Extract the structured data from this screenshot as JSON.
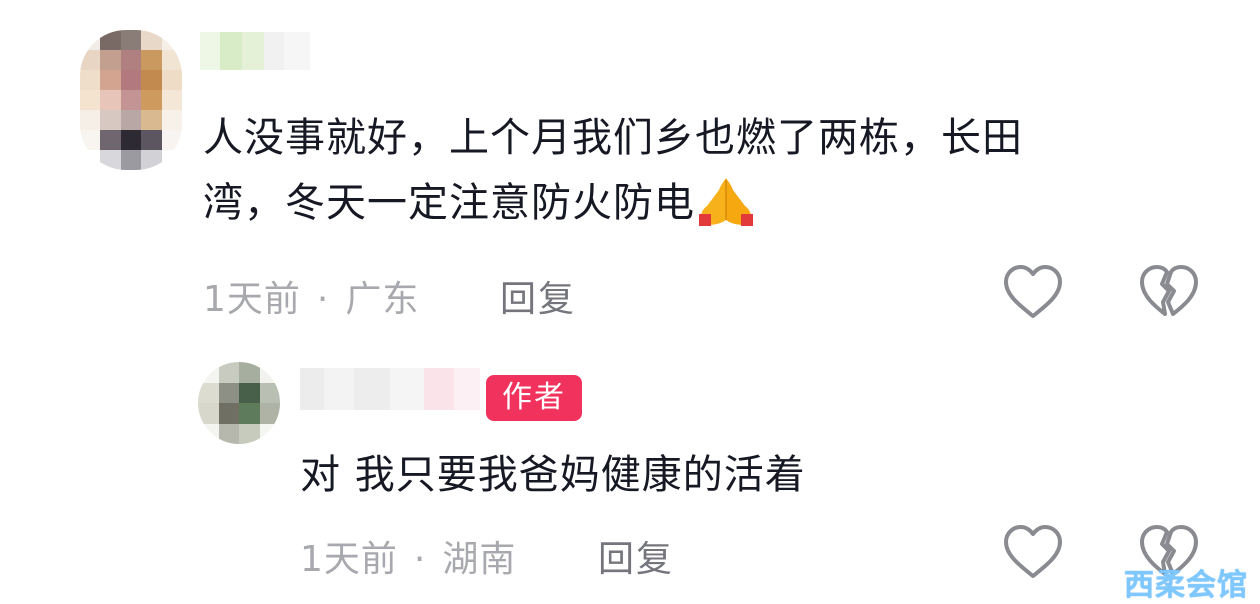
{
  "comments": [
    {
      "text_line1": "人没事就好，上个月我们乡也燃了两栋，长田",
      "text_line2": "湾，冬天一定注意防火防电",
      "emoji": "folded-hands-icon",
      "time": "1天前",
      "location": "广东",
      "separator": "·",
      "reply_label": "回复"
    },
    {
      "badge": "作者",
      "text": "对 我只要我爸妈健康的活着",
      "time": "1天前",
      "location": "湖南",
      "separator": "·",
      "reply_label": "回复"
    }
  ],
  "watermark": "西柔会馆",
  "colors": {
    "badge_bg": "#f0325c",
    "text": "#161823",
    "meta": "#a8a9ae",
    "reply": "#75767d",
    "watermark": "#7ec7ff"
  }
}
